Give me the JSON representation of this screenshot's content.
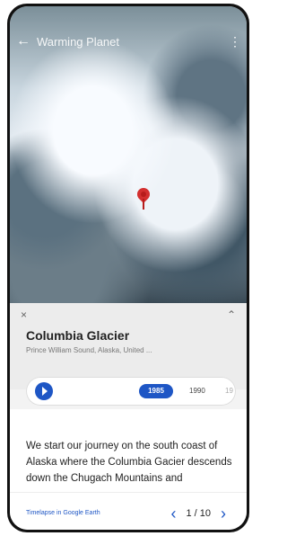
{
  "status_bar": {
    "left_text": "",
    "right_text": ""
  },
  "app_bar": {
    "title": "Warming Planet",
    "back_icon": "arrow-left",
    "menu_icon": "more-vert"
  },
  "place": {
    "name": "Columbia Glacier",
    "location": "Prince William Sound, Alaska, United ..."
  },
  "timeline": {
    "selected_year": "1985",
    "next_year": "1990",
    "third_year": "19"
  },
  "story": {
    "text": "We start our journey on the south coast of Alaska where the Columbia Gacier descends down the Chugach Mountains and"
  },
  "footer": {
    "link_text": "Timelapse in Google Earth",
    "page_count": "1 / 10"
  },
  "colors": {
    "accent": "#1e56c5",
    "pin": "#d32f2f"
  }
}
